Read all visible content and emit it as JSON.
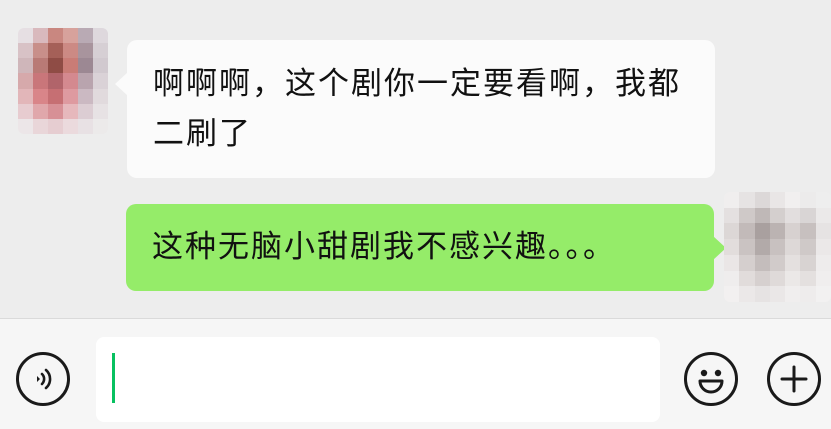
{
  "conversation": {
    "incoming": {
      "text": "啊啊啊，这个剧你一定要看啊，我都二刷了"
    },
    "outgoing": {
      "text": "这种无脑小甜剧我不感兴趣。。。"
    }
  },
  "input_bar": {
    "text_value": "",
    "icons": {
      "voice": "voice-icon",
      "emoji": "emoji-icon",
      "more": "plus-icon"
    }
  },
  "colors": {
    "chat_background": "#ededed",
    "incoming_bubble": "#fbfbfb",
    "outgoing_bubble": "#95ec69",
    "caret": "#07c160"
  }
}
